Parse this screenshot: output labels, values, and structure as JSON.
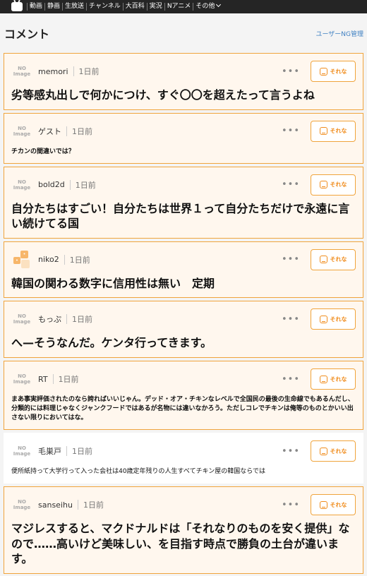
{
  "nav": {
    "items": [
      "動画",
      "静画",
      "生放送",
      "チャンネル",
      "大百科",
      "実況",
      "Nアニメ",
      "その他"
    ]
  },
  "header": {
    "title": "コメント",
    "ng_link": "ユーザーNG管理"
  },
  "avatar": {
    "placeholder_line1": "NO",
    "placeholder_line2": "Image"
  },
  "reaction_label": "それな",
  "comments": [
    {
      "name": "memori",
      "time": "1日前",
      "text": "劣等感丸出しで何かにつけ、すぐ〇〇を超えたって言うよね"
    },
    {
      "name": "ゲスト",
      "time": "1日前",
      "text": "チカンの間違いでは？"
    },
    {
      "name": "bold2d",
      "time": "1日前",
      "text": "自分たちはすごい！自分たちは世界１って自分たちだけで永遠に言い続けてる国"
    },
    {
      "name": "niko2",
      "time": "1日前",
      "text": "韓国の関わる数字に信用性は無い　定期"
    },
    {
      "name": "もっぷ",
      "time": "1日前",
      "text": "へ—そうなんだ。ケンタ行ってきます。"
    },
    {
      "name": "RT",
      "time": "1日前",
      "text": "まあ事実評価されたのなら誇ればいいじゃん。デッド・オア・チキンなレベルで全国民の最後の生命線でもあるんだし、分類的には料理じゃなくジャンクフードではあるが名物には違いなかろう。ただしコレでチキンは俺等のものとかいい出さない限りにおいてはな。"
    },
    {
      "name": "毛巣戸",
      "time": "1日前",
      "text": "便所紙持って大学行って入った会社は40歳定年残りの人生すべてチキン屋の韓国ならでは"
    },
    {
      "name": "sanseihu",
      "time": "1日前",
      "text": "マジレスすると、マクドナルドは「それなりのものを安く提供」なので……高いけど美味しい、を目指す時点で勝負の土台が違います。"
    }
  ],
  "colors": {
    "accent": "#f08c1c",
    "border": "#f0a43c",
    "card_bg": "#fff7ee",
    "link": "#3d7fc2",
    "topbar": "#252525"
  }
}
